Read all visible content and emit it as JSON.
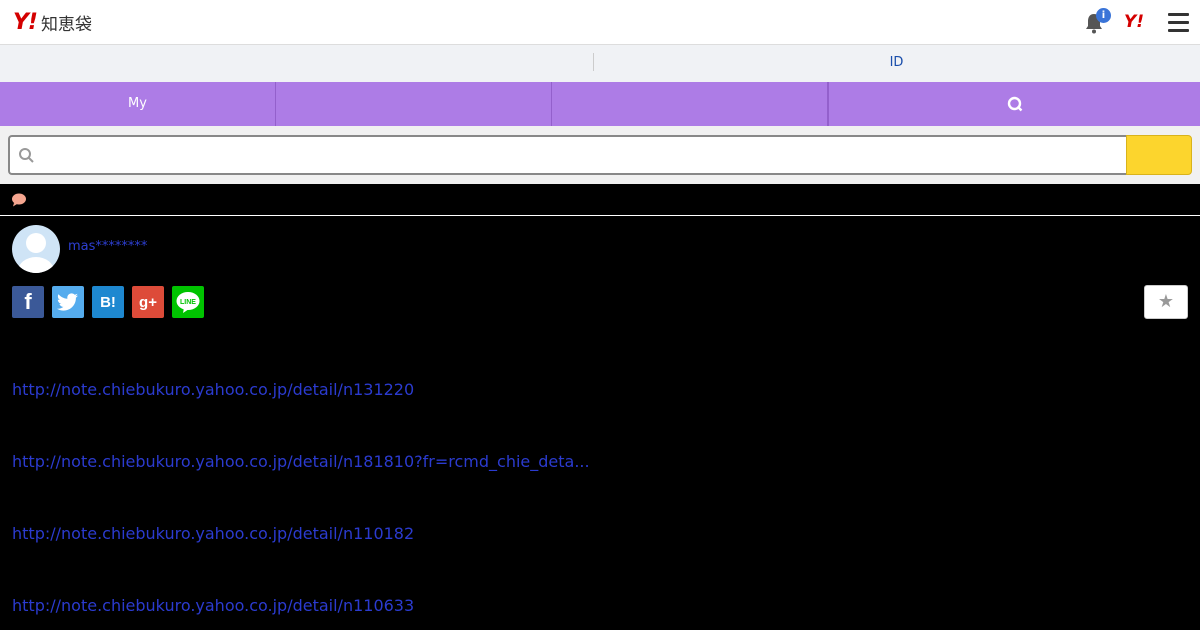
{
  "header": {
    "logo_y": "Y!",
    "logo_name": "知恵袋",
    "notification_badge": "i",
    "yahoo_link": "Y!"
  },
  "id_bar": {
    "left_text": "",
    "id_label": "ID"
  },
  "nav": {
    "tabs": [
      {
        "label": "My"
      },
      {
        "label": ""
      },
      {
        "label": ""
      }
    ]
  },
  "search": {
    "placeholder": "",
    "value": "",
    "button_label": ""
  },
  "question": {
    "username": "mas********"
  },
  "share": {
    "facebook": "f",
    "twitter": "t",
    "hatena": "B!",
    "google_plus": "g+",
    "line": "LINE"
  },
  "favorite_label": "★",
  "links": [
    "http://note.chiebukuro.yahoo.co.jp/detail/n131220",
    "http://note.chiebukuro.yahoo.co.jp/detail/n181810?fr=rcmd_chie_deta...",
    "http://note.chiebukuro.yahoo.co.jp/detail/n110182",
    "http://note.chiebukuro.yahoo.co.jp/detail/n110633"
  ],
  "colors": {
    "nav_bg": "#ad7ce6",
    "search_button": "#fcd52d",
    "link": "#2b3bcf",
    "brand_red": "#d40000"
  }
}
